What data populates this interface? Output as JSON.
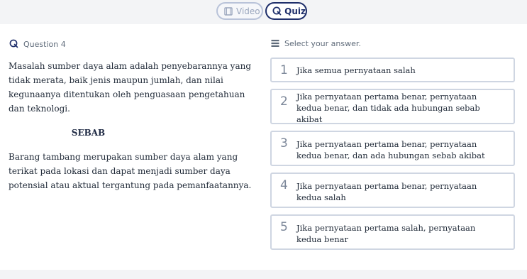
{
  "tabs": {
    "video_label": "Video",
    "quiz_label": "Quiz"
  },
  "question": {
    "header": "Question 4",
    "statement_1": "Masalah sumber daya alam adalah penyebarannya yang tidak merata, baik jenis maupun jumlah, dan nilai kegunaanya ditentukan oleh penguasaan pengetahuan dan teknologi.",
    "connector": "SEBAB",
    "statement_2": "Barang tambang merupakan sumber daya alam yang terikat pada lokasi dan dapat menjadi sumber daya potensial atau aktual tergantung pada pemanfaatannya."
  },
  "answers": {
    "header": "Select your answer.",
    "options": [
      {
        "num": "1",
        "text": "Jika semua pernyataan salah"
      },
      {
        "num": "2",
        "text": "Jika pernyataan pertama benar, pernyataan kedua benar, dan tidak ada hubungan sebab akibat"
      },
      {
        "num": "3",
        "text": "Jika pernyataan pertama benar, pernyataan kedua benar, dan ada hubungan sebab akibat"
      },
      {
        "num": "4",
        "text": "Jika pernyataan pertama benar, pernyataan kedua salah"
      },
      {
        "num": "5",
        "text": "Jika pernyataan pertama salah, pernyataan kedua benar"
      }
    ]
  },
  "colors": {
    "accent": "#1f2f6b",
    "inactive_tab": "#b9c3d9",
    "answer_border": "#cfd6e2"
  }
}
